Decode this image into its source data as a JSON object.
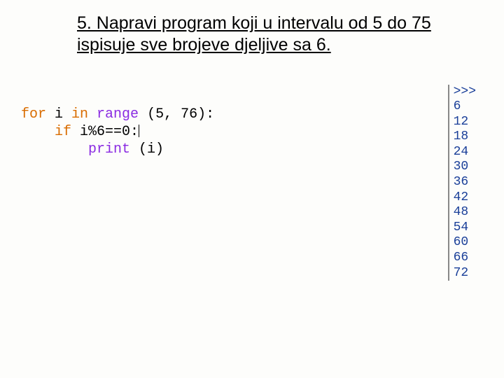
{
  "title": "5. Napravi program koji u intervalu od 5 do 75 ispisuje sve brojeve djeljive sa 6.",
  "code": {
    "l1_for": "for",
    "l1_var": " i ",
    "l1_in": "in",
    "l1_range": " range",
    "l1_args": " (5, 76):",
    "l2_indent": "    ",
    "l2_if": "if",
    "l2_cond": " i%6==0:",
    "l3_indent": "        ",
    "l3_print": "print",
    "l3_args": " (i)"
  },
  "output": {
    "prompt": ">>> ",
    "lines": [
      "6",
      "12",
      "18",
      "24",
      "30",
      "36",
      "42",
      "48",
      "54",
      "60",
      "66",
      "72"
    ]
  }
}
